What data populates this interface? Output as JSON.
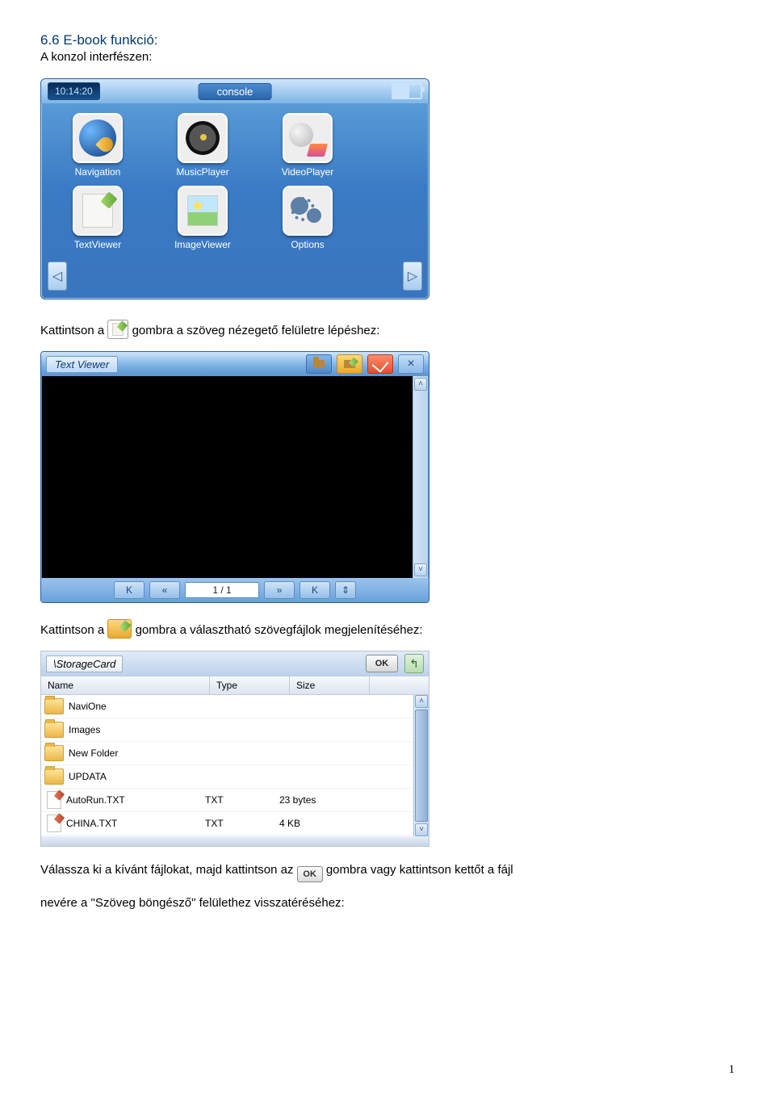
{
  "headings": {
    "title": "6.6 E-book funkció:",
    "sub": "A konzol interfészen:"
  },
  "console": {
    "clock": "10:14:20",
    "title": "console",
    "apps": {
      "nav": "Navigation",
      "music": "MusicPlayer",
      "video": "VideoPlayer",
      "text": "TextViewer",
      "image": "ImageViewer",
      "options": "Options"
    }
  },
  "para1": {
    "before": "Kattintson a ",
    "after": " gombra a szöveg nézegető felületre lépéshez:"
  },
  "viewer": {
    "title": "Text Viewer",
    "nav": {
      "first": "K",
      "prev": "«",
      "page": "1 / 1",
      "next": "»",
      "last": "K",
      "updown": "⇕"
    },
    "close": "×"
  },
  "para2": {
    "before": "Kattintson a ",
    "after": " gombra a választható szövegfájlok megjelenítéséhez:"
  },
  "browser": {
    "path": "\\StorageCard",
    "ok": "OK",
    "up": "↰",
    "cols": {
      "name": "Name",
      "type": "Type",
      "size": "Size"
    },
    "rows": [
      {
        "kind": "folder",
        "name": "NaviOne",
        "type": "",
        "size": ""
      },
      {
        "kind": "folder",
        "name": "Images",
        "type": "",
        "size": ""
      },
      {
        "kind": "folder",
        "name": "New Folder",
        "type": "",
        "size": ""
      },
      {
        "kind": "folder",
        "name": "UPDATA",
        "type": "",
        "size": ""
      },
      {
        "kind": "file",
        "name": "AutoRun.TXT",
        "type": "TXT",
        "size": "23 bytes"
      },
      {
        "kind": "file",
        "name": "CHINA.TXT",
        "type": "TXT",
        "size": "4 KB"
      }
    ]
  },
  "para3": {
    "l1a": "Válassza ki a kívánt fájlokat, majd kattintson az ",
    "l1b": " gombra vagy kattintson kettőt a fájl",
    "l2": "nevére a \"Szöveg böngésző\" felülethez visszatéréséhez:",
    "ok": "OK"
  },
  "page_number": "1"
}
